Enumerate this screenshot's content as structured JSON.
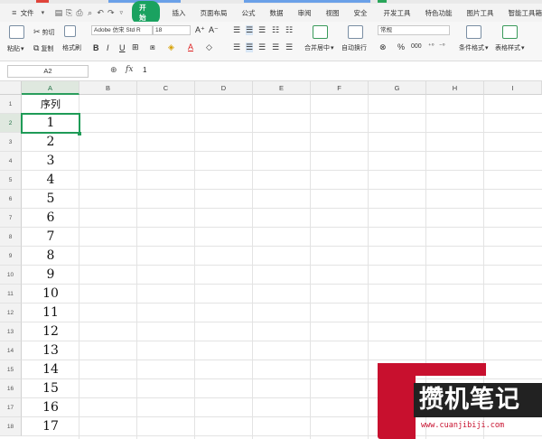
{
  "menubar": {
    "file_label": "文件",
    "start_tab": "开始",
    "tabs": [
      "插入",
      "页面布局",
      "公式",
      "数据",
      "审阅",
      "视图",
      "安全",
      "开发工具",
      "特色功能",
      "图片工具",
      "智能工具箱"
    ]
  },
  "ribbon": {
    "paste": "粘贴",
    "cut": "剪切",
    "copy": "复制",
    "format_painter": "格式刷",
    "font_name": "Adobe 仿宋 Std R",
    "font_size": "18",
    "merge_center": "合并居中",
    "wrap_text": "自动换行",
    "number_format": "常规",
    "conditional_format": "条件格式",
    "table_style": "表格样式",
    "bold": "B",
    "italic": "I",
    "underline": "U",
    "grow_font": "A⁺",
    "shrink_font": "A⁻",
    "percent": "%",
    "thousands": "000"
  },
  "formula_bar": {
    "name_box": "A2",
    "fx_label": "fx",
    "value": "1"
  },
  "sheet": {
    "columns": [
      "A",
      "B",
      "C",
      "D",
      "E",
      "F",
      "G",
      "H",
      "I"
    ],
    "row_numbers": [
      "1",
      "2",
      "3",
      "4",
      "5",
      "6",
      "7",
      "8",
      "9",
      "10",
      "11",
      "12",
      "13",
      "14",
      "15",
      "16",
      "17",
      "18"
    ],
    "a_column": [
      "序列",
      "1",
      "2",
      "3",
      "4",
      "5",
      "6",
      "7",
      "8",
      "9",
      "10",
      "11",
      "12",
      "13",
      "14",
      "15",
      "16",
      "17"
    ],
    "selected_cell": "A2"
  },
  "watermark": {
    "brand": "攒机笔记",
    "url": "www.cuanjibiji.com"
  },
  "colors": {
    "accent_green": "#1aa260",
    "selection_green": "#1f9b57",
    "watermark_red": "#c8102e"
  }
}
